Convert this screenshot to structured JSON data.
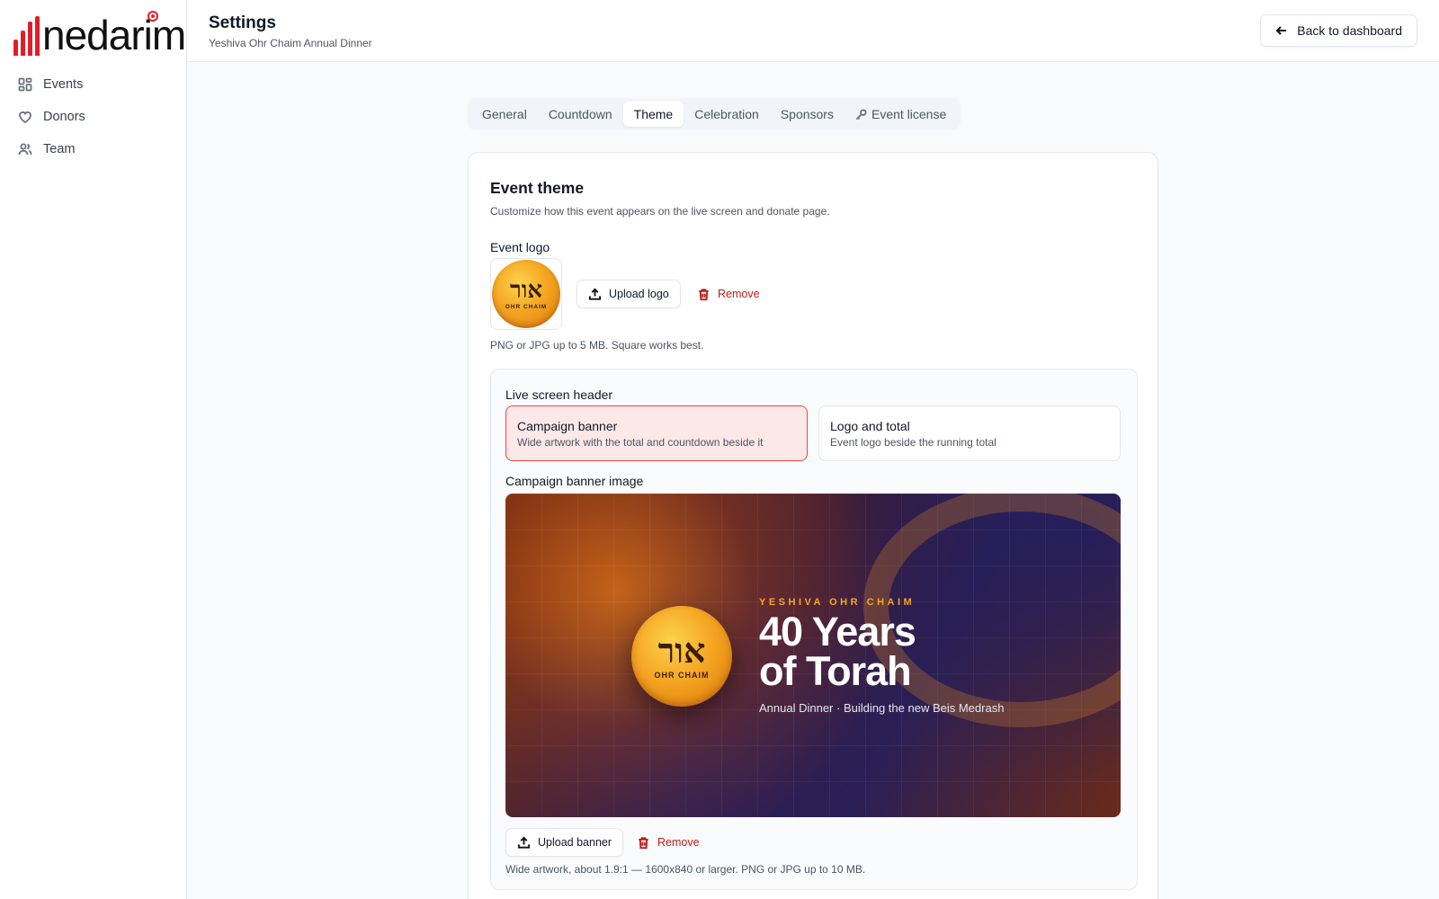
{
  "brand": {
    "name": "nedarim",
    "bar_colors": [
      "#e11d2a",
      "#e11d2a",
      "#e11d2a",
      "#e11d2a"
    ]
  },
  "sidebar": {
    "items": [
      {
        "label": "Events",
        "icon": "grid-icon"
      },
      {
        "label": "Donors",
        "icon": "heart-icon"
      },
      {
        "label": "Team",
        "icon": "users-icon"
      }
    ]
  },
  "header": {
    "title": "Settings",
    "subtitle": "Yeshiva Ohr Chaim Annual Dinner",
    "back_label": "Back to dashboard"
  },
  "tabs": [
    {
      "label": "General",
      "active": false
    },
    {
      "label": "Countdown",
      "active": false
    },
    {
      "label": "Theme",
      "active": true
    },
    {
      "label": "Celebration",
      "active": false
    },
    {
      "label": "Sponsors",
      "active": false
    },
    {
      "label": "Event license",
      "active": false,
      "icon": "key-icon"
    }
  ],
  "theme": {
    "title": "Event theme",
    "description": "Customize how this event appears on the live screen and donate page.",
    "logo_label": "Event logo",
    "logo_heb": "אור",
    "logo_sub": "OHR CHAIM",
    "upload_logo": "Upload logo",
    "remove": "Remove",
    "logo_hint": "PNG or JPG up to 5 MB. Square works best.",
    "header_label": "Live screen header",
    "options": [
      {
        "title": "Campaign banner",
        "desc": "Wide artwork with the total and countdown beside it",
        "selected": true
      },
      {
        "title": "Logo and total",
        "desc": "Event logo beside the running total",
        "selected": false
      }
    ],
    "banner_label": "Campaign banner image",
    "banner": {
      "kicker": "YESHIVA OHR CHAIM",
      "title_line1": "40 Years",
      "title_line2": "of Torah",
      "tagline": "Annual Dinner · Building the new Beis Medrash",
      "coin_heb": "אור",
      "coin_sub": "OHR CHAIM"
    },
    "upload_banner": "Upload banner",
    "banner_hint": "Wide artwork, about 1.9:1 — 1600x840 or larger. PNG or JPG up to 10 MB."
  },
  "colors": {
    "accent": "#ef4444",
    "remove": "#b91c1c",
    "gold": "#f5a623"
  }
}
